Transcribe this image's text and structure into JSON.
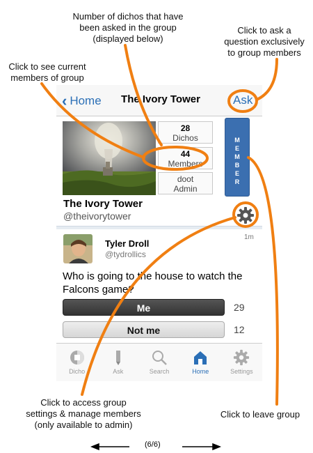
{
  "callouts": {
    "dichos_count": "Number of dichos that have\nbeen asked in the group\n(displayed below)",
    "ask_exclusive": "Click to ask a\nquestion exclusively\nto group members",
    "see_members": "Click to see current\nmembers of group",
    "group_settings": "Click to access group\nsettings & manage members\n(only available to admin)",
    "leave_group": "Click to leave group"
  },
  "nav": {
    "back_label": "Home",
    "title": "The Ivory Tower",
    "ask_label": "Ask"
  },
  "group": {
    "name": "The Ivory Tower",
    "handle": "@theivorytower",
    "stats": {
      "dichos_count": "28",
      "dichos_label": "Dichos",
      "members_count": "44",
      "members_label": "Members",
      "admin_name": "doot",
      "admin_label": "Admin"
    },
    "member_button_letters": [
      "M",
      "E",
      "M",
      "B",
      "E",
      "R"
    ]
  },
  "post": {
    "time": "1m",
    "user": "Tyler Droll",
    "handle": "@tydrollics",
    "question": "Who is going to the house to watch the Falcons game?",
    "options": [
      {
        "label": "Me",
        "count": "29"
      },
      {
        "label": "Not me",
        "count": "12"
      }
    ]
  },
  "tabs": [
    {
      "label": "Dicho",
      "icon": "dicho-icon"
    },
    {
      "label": "Ask",
      "icon": "pencil-icon"
    },
    {
      "label": "Search",
      "icon": "search-icon"
    },
    {
      "label": "Home",
      "icon": "home-icon",
      "active": true
    },
    {
      "label": "Settings",
      "icon": "gear-icon"
    }
  ],
  "page_indicator": "(6/6)",
  "colors": {
    "accent": "#2b6fb6",
    "highlight": "#f07f12",
    "member_button": "#3b6fb0"
  }
}
